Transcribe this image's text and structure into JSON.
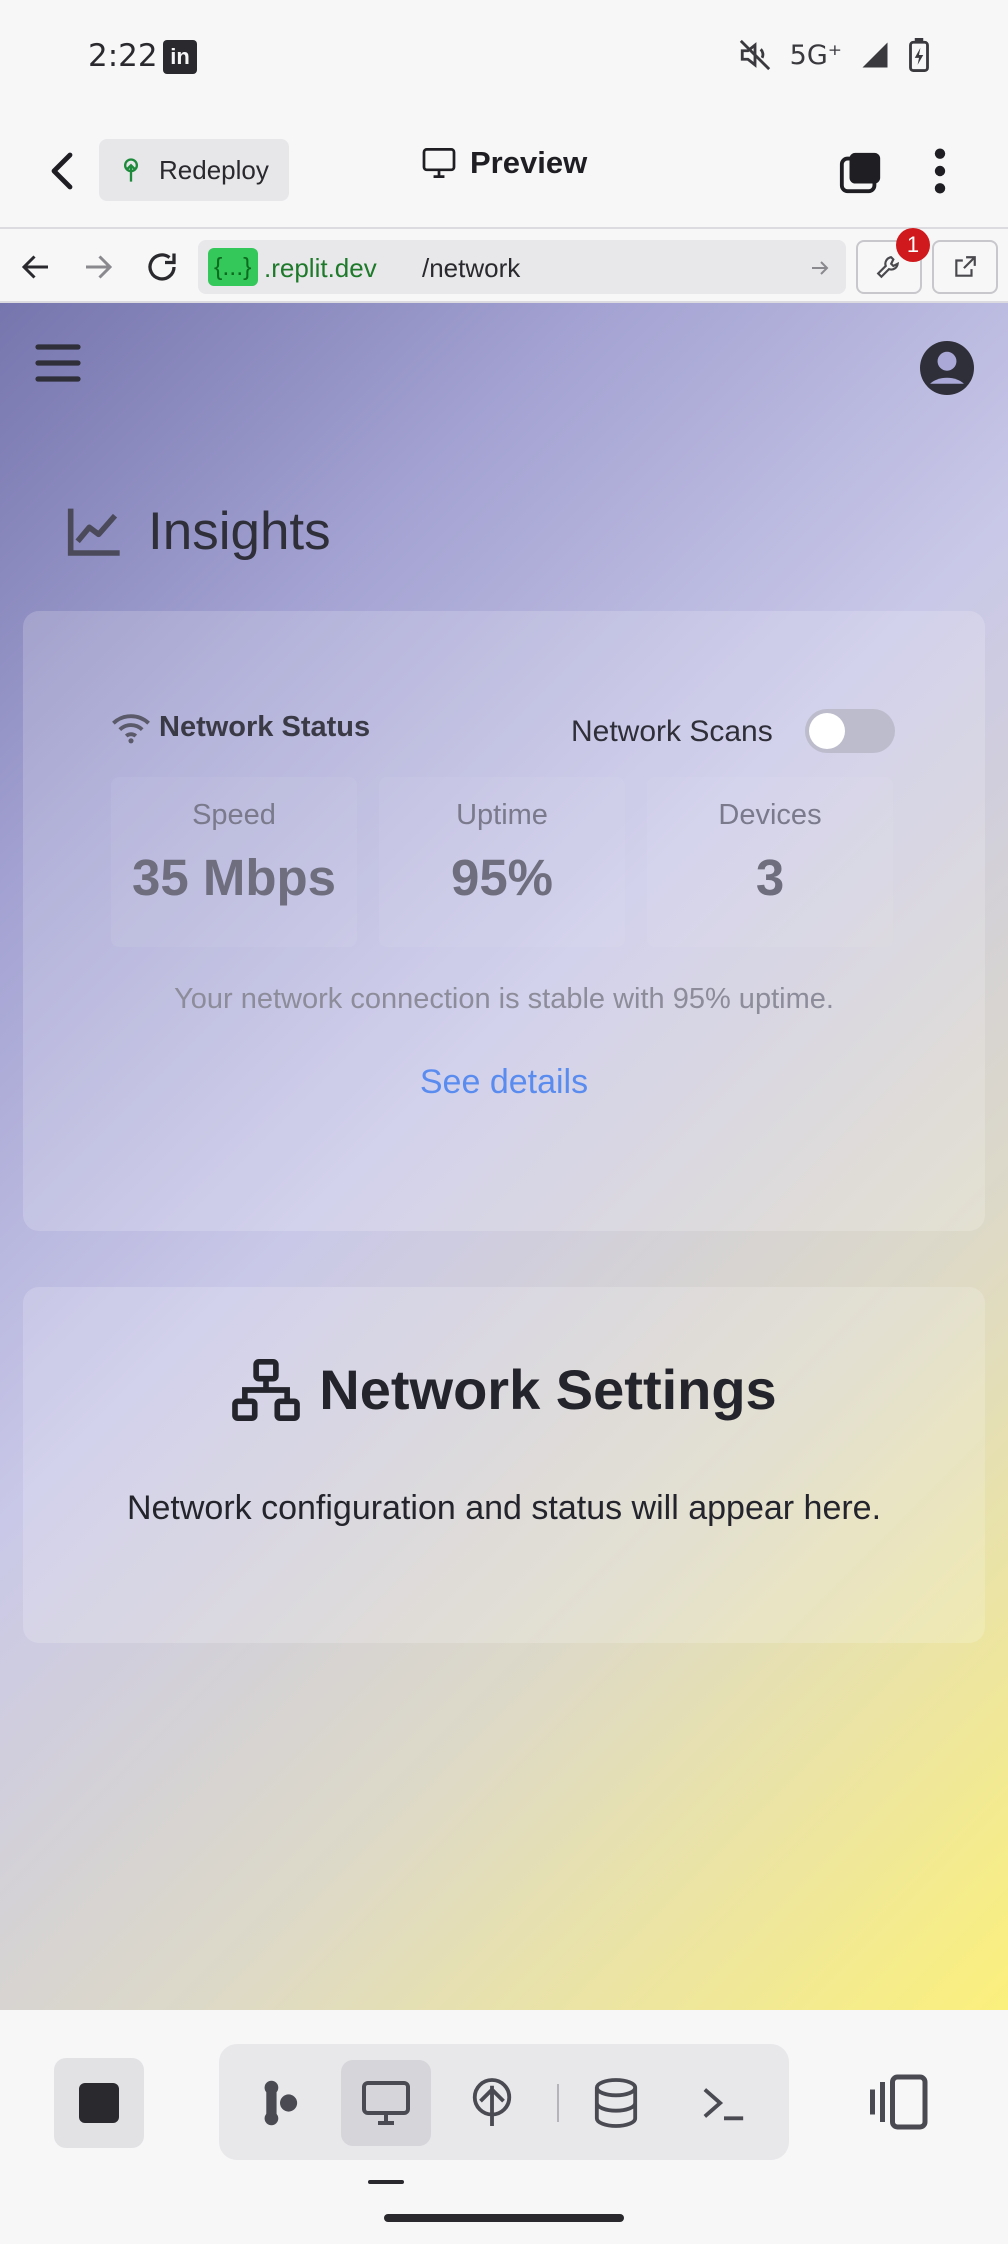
{
  "status_bar": {
    "time": "2:22",
    "app_icon": "linkedin-icon",
    "network": "5G⁺",
    "icons": [
      "mute-icon",
      "signal-icon",
      "battery-icon"
    ]
  },
  "app_header": {
    "redeploy_label": "Redeploy",
    "title": "Preview"
  },
  "url_bar": {
    "host_badge": "{...}",
    "host": ".replit.dev",
    "path": "/network",
    "devtools_badge": "1"
  },
  "page": {
    "section_title": "Insights",
    "network_card": {
      "title": "Network Status",
      "scan_label": "Network Scans",
      "scan_enabled": false,
      "stats": [
        {
          "label": "Speed",
          "value": "35 Mbps"
        },
        {
          "label": "Uptime",
          "value": "95%"
        },
        {
          "label": "Devices",
          "value": "3"
        }
      ],
      "message": "Your network connection is stable with 95% uptime.",
      "details_link": "See details"
    },
    "settings_card": {
      "title": "Network Settings",
      "message": "Network configuration and status will appear here."
    }
  },
  "colors": {
    "accent_link": "#5a8cf0",
    "host_badge": "#34c759",
    "badge_red": "#d0191c"
  }
}
